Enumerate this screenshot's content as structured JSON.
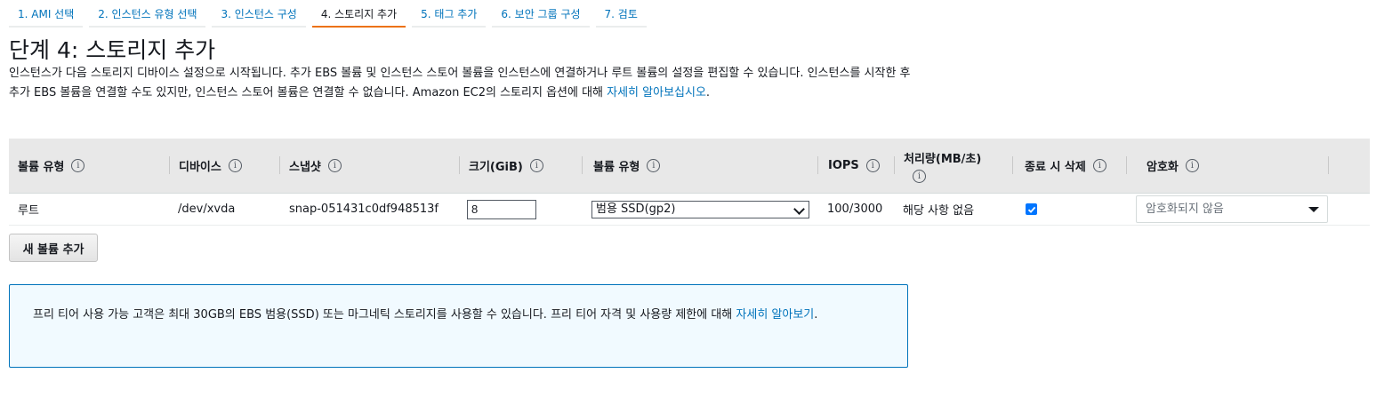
{
  "wizard": {
    "tabs": [
      {
        "label": "1. AMI 선택"
      },
      {
        "label": "2. 인스턴스 유형 선택"
      },
      {
        "label": "3. 인스턴스 구성"
      },
      {
        "label": "4. 스토리지 추가"
      },
      {
        "label": "5. 태그 추가"
      },
      {
        "label": "6. 보안 그룹 구성"
      },
      {
        "label": "7. 검토"
      }
    ],
    "active_tab": "4. 스토리지 추가"
  },
  "page": {
    "title": "단계 4: 스토리지 추가",
    "description": "인스턴스가 다음 스토리지 디바이스 설정으로 시작됩니다. 추가 EBS 볼륨 및 인스턴스 스토어 볼륨을 인스턴스에 연결하거나 루트 볼륨의 설정을 편집할 수 있습니다. 인스턴스를 시작한 후 추가 EBS 볼륨을 연결할 수도 있지만, 인스턴스 스토어 볼륨은 연결할 수 없습니다. Amazon EC2의 스토리지 옵션에 대해 ",
    "learn_more_link": "자세히 알아보십시오",
    "description_end": "."
  },
  "table": {
    "headers": {
      "volume_type": "볼륨 유형",
      "device": "디바이스",
      "snapshot": "스냅샷",
      "size": "크기(GiB)",
      "ebs_volume_type": "볼륨 유형",
      "iops": "IOPS",
      "throughput": "처리량(MB/초)",
      "delete_on_termination": "종료 시 삭제",
      "encryption": "암호화"
    },
    "info_icon": "i",
    "rows": [
      {
        "volume_type": "루트",
        "device": "/dev/xvda",
        "snapshot": "snap-051431c0df948513f",
        "size": "8",
        "ebs_volume_type": "범용 SSD(gp2)",
        "iops": "100/3000",
        "throughput": "해당 사항 없음",
        "delete_on_termination": true,
        "encryption": "암호화되지 않음"
      }
    ]
  },
  "buttons": {
    "add_volume": "새 볼륨 추가"
  },
  "info_box": {
    "text": "프리 티어 사용 가능 고객은 최대 30GB의 EBS 범용(SSD) 또는 마그네틱 스토리지를 사용할 수 있습니다. 프리 티어 자격 및 사용량 제한에 대해 ",
    "link": "자세히 알아보기",
    "end": "."
  },
  "colors": {
    "link": "#0073bb",
    "active_tab_underline": "#ec7211",
    "header_bg": "#e8e8e8",
    "info_box_border": "#0073bb",
    "info_box_bg": "#f1faff",
    "checkbox": "#0075ff"
  }
}
